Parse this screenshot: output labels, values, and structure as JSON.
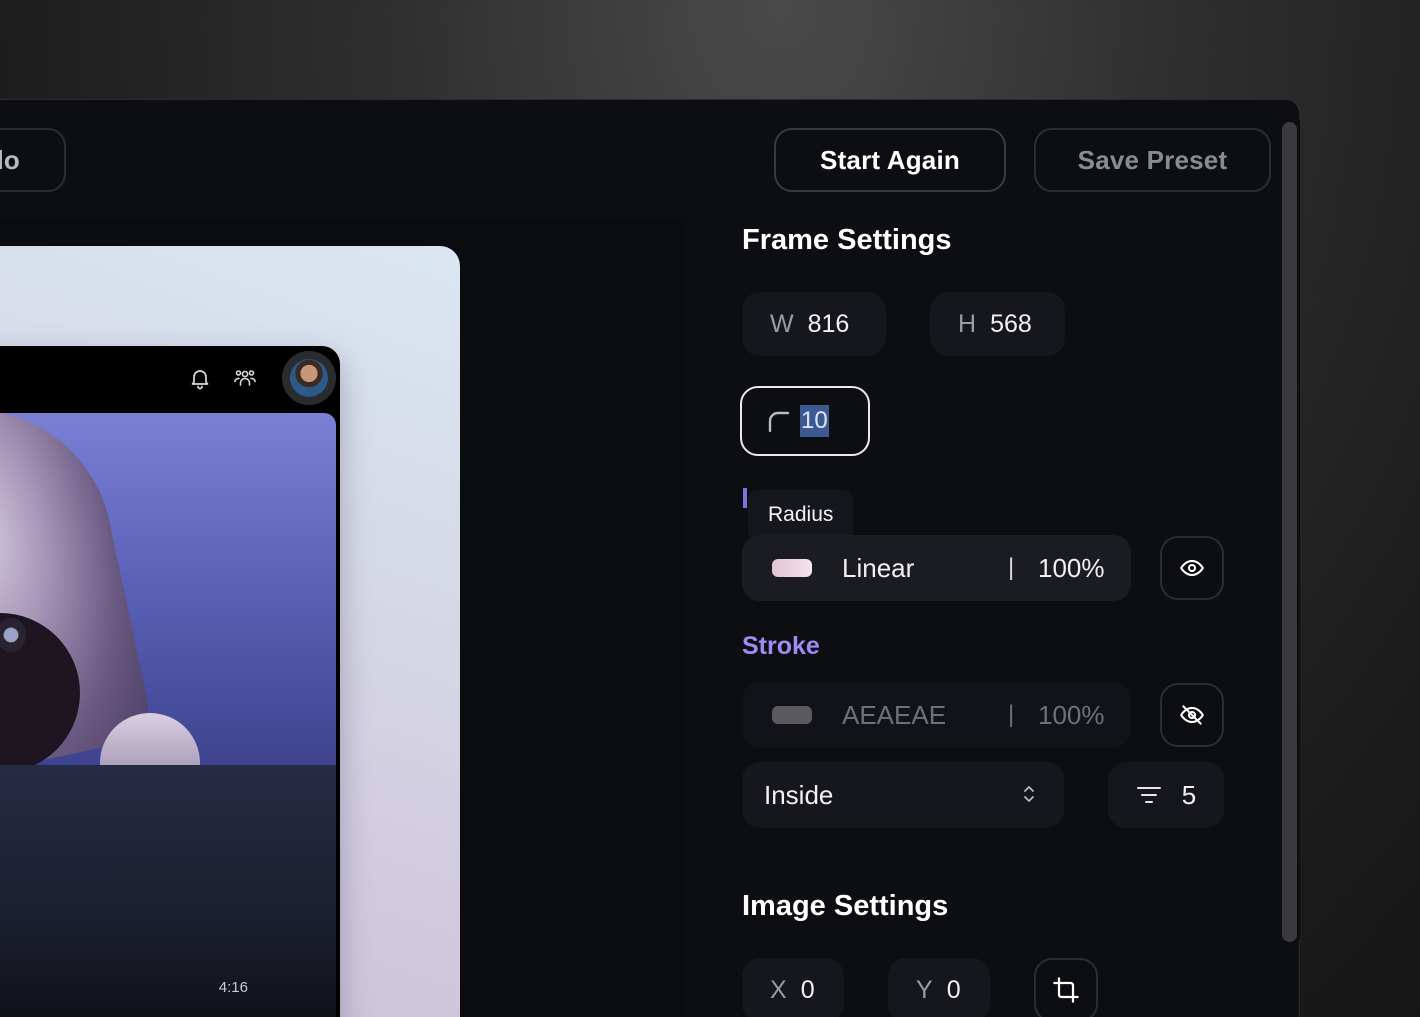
{
  "toolbar": {
    "undo_label": "Undo",
    "start_again_label": "Start Again",
    "save_preset_label": "Save Preset"
  },
  "canvas": {
    "timestamp": "4:16",
    "icons": [
      "bell-icon",
      "people-icon",
      "avatar"
    ]
  },
  "frame_settings": {
    "title": "Frame Settings",
    "width_label": "W",
    "width_value": "816",
    "height_label": "H",
    "height_value": "568",
    "radius_value": "10",
    "radius_tooltip": "Radius",
    "fill": {
      "type": "Linear",
      "separator": "|",
      "opacity": "100%",
      "visible": true
    },
    "stroke": {
      "title": "Stroke",
      "color": "AEAEAE",
      "separator": "|",
      "opacity": "100%",
      "visible": false,
      "position": "Inside",
      "weight": "5"
    }
  },
  "image_settings": {
    "title": "Image Settings",
    "x_label": "X",
    "x_value": "0",
    "y_label": "Y",
    "y_value": "0"
  },
  "colors": {
    "accent": "#a08bf5",
    "panel_bg": "#0d0e12",
    "chip_bg": "#16171d",
    "stroke_swatch": "#5a5a5e"
  }
}
